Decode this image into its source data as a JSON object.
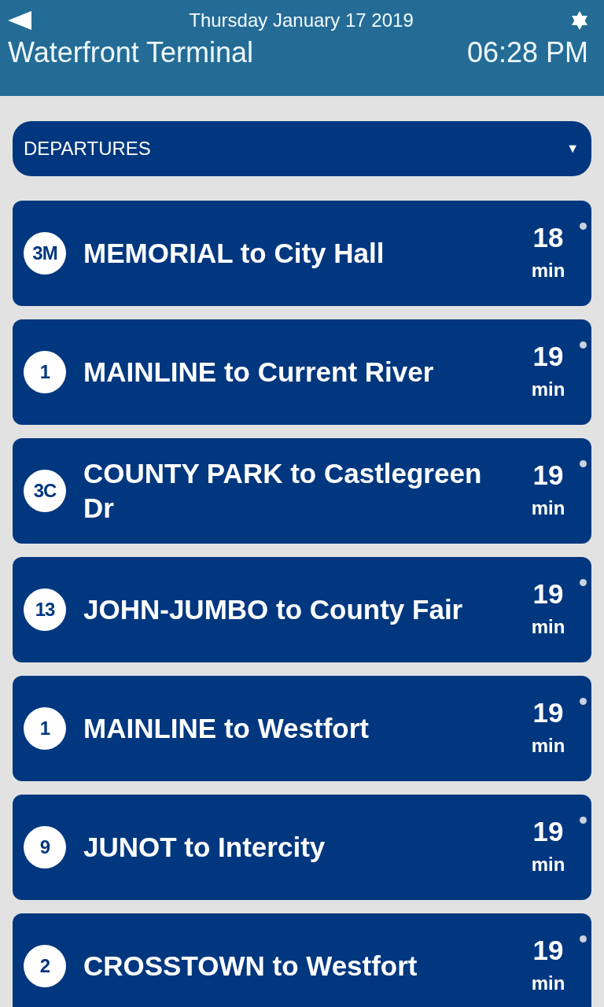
{
  "header": {
    "date": "Thursday January 17 2019",
    "station": "Waterfront Terminal",
    "time": "06:28 PM"
  },
  "dropdown": {
    "label": "DEPARTURES",
    "caret": "▼"
  },
  "departures": [
    {
      "route": "3M",
      "destination": "MEMORIAL to City Hall",
      "minutes": "18",
      "unit": "min"
    },
    {
      "route": "1",
      "destination": "MAINLINE to Current River",
      "minutes": "19",
      "unit": "min"
    },
    {
      "route": "3C",
      "destination": "COUNTY PARK to Castlegreen Dr",
      "minutes": "19",
      "unit": "min"
    },
    {
      "route": "13",
      "destination": "JOHN-JUMBO to County Fair",
      "minutes": "19",
      "unit": "min"
    },
    {
      "route": "1",
      "destination": "MAINLINE to Westfort",
      "minutes": "19",
      "unit": "min"
    },
    {
      "route": "9",
      "destination": "JUNOT to Intercity",
      "minutes": "19",
      "unit": "min"
    },
    {
      "route": "2",
      "destination": "CROSSTOWN to Westfort",
      "minutes": "19",
      "unit": "min"
    }
  ]
}
